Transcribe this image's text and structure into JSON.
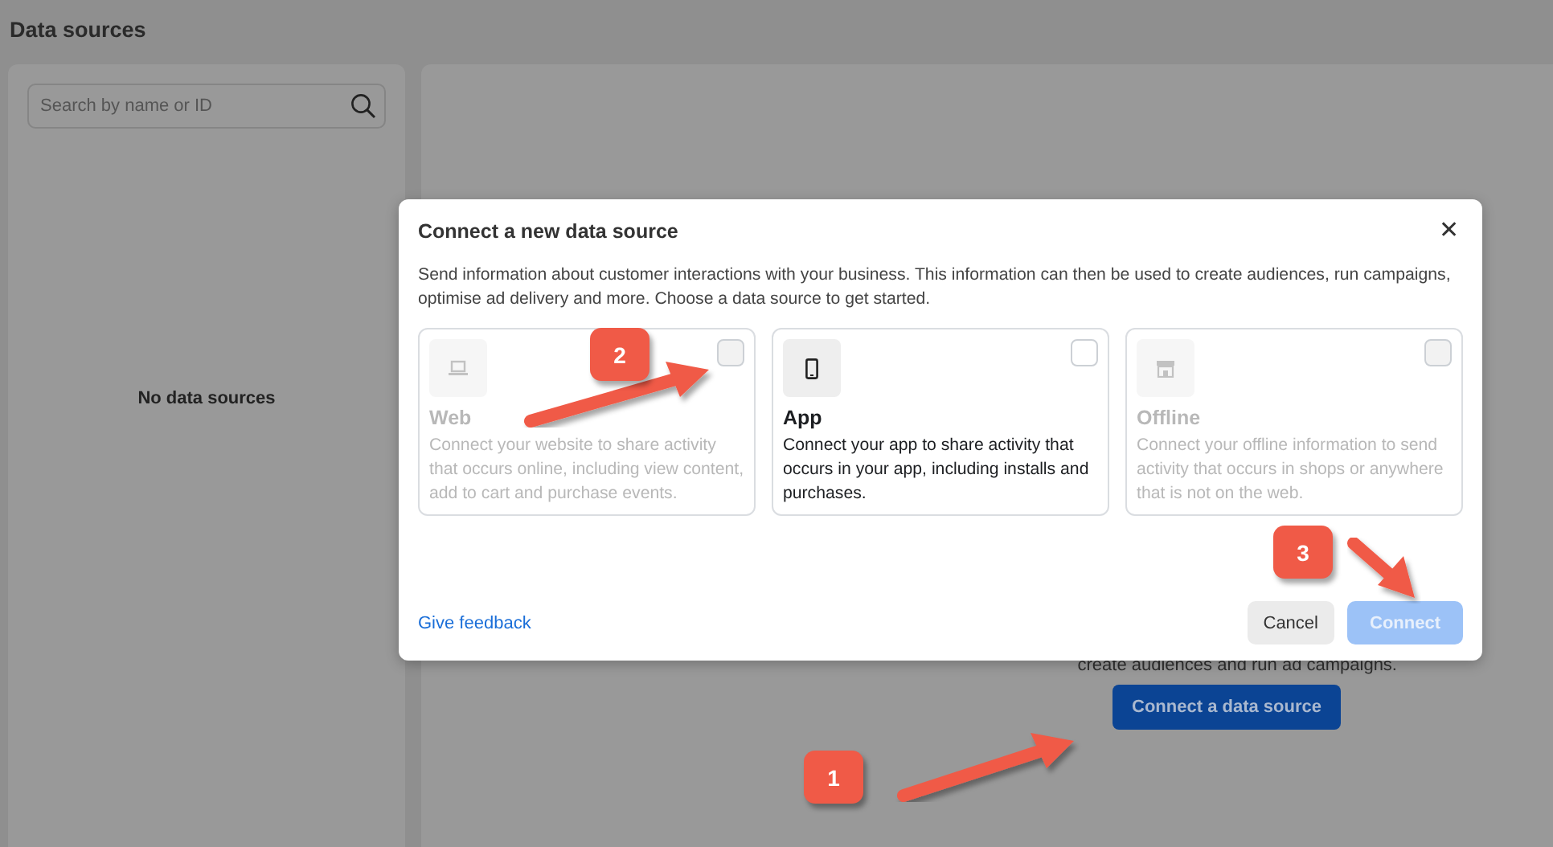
{
  "page": {
    "title": "Data sources"
  },
  "sidebar": {
    "search": {
      "placeholder": "Search by name or ID"
    },
    "empty_message": "No data sources"
  },
  "main": {
    "description_fragment": "create audiences and run ad campaigns.",
    "button": "Connect a data source"
  },
  "modal": {
    "title": "Connect a new data source",
    "close": "✕",
    "description": "Send information about customer interactions with your business. This information can then be used to create audiences, run campaigns, optimise ad delivery and more. Choose a data source to get started.",
    "options": [
      {
        "kind": "web",
        "title": "Web",
        "text": "Connect your website to share activity that occurs online, including view content, add to cart and purchase events.",
        "disabled": true,
        "checked": false
      },
      {
        "kind": "app",
        "title": "App",
        "text": "Connect your app to share activity that occurs in your app, including installs and purchases.",
        "disabled": false,
        "checked": false
      },
      {
        "kind": "offline",
        "title": "Offline",
        "text": "Connect your offline information to send activity that occurs in shops or anywhere that is not on the web.",
        "disabled": true,
        "checked": false
      }
    ],
    "link": "Give feedback",
    "buttons": [
      {
        "label": "Cancel",
        "kind": "secondary",
        "disabled": false
      },
      {
        "label": "Connect",
        "kind": "primary",
        "disabled": true
      }
    ]
  },
  "callouts": [
    {
      "number": "1"
    },
    {
      "number": "2"
    },
    {
      "number": "3"
    }
  ]
}
